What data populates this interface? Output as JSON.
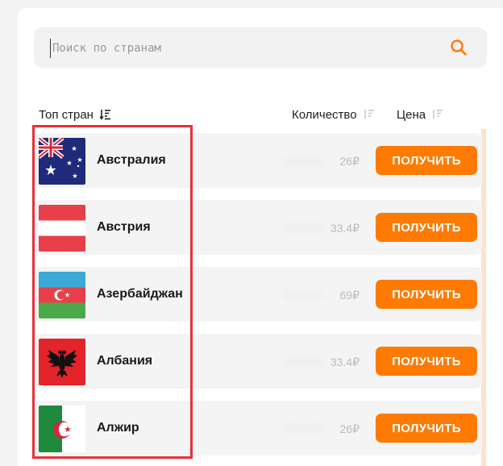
{
  "search": {
    "placeholder": "Поиск по странам",
    "value": ""
  },
  "table": {
    "col_country": "Топ стран",
    "col_quantity": "Количество",
    "col_price": "Цена"
  },
  "colors": {
    "accent": "#ff7a00",
    "highlight": "#e8303a"
  },
  "countries": [
    {
      "name": "Австралия",
      "price": "26₽",
      "button": "ПОЛУЧИТЬ",
      "flag": "flag-australia-icon"
    },
    {
      "name": "Австрия",
      "price": "33.4₽",
      "button": "ПОЛУЧИТЬ",
      "flag": "flag-austria-icon"
    },
    {
      "name": "Азербайджан",
      "price": "69₽",
      "button": "ПОЛУЧИТЬ",
      "flag": "flag-azerbaijan-icon"
    },
    {
      "name": "Албания",
      "price": "33.4₽",
      "button": "ПОЛУЧИТЬ",
      "flag": "flag-albania-icon"
    },
    {
      "name": "Алжир",
      "price": "26₽",
      "button": "ПОЛУЧИТЬ",
      "flag": "flag-algeria-icon"
    }
  ]
}
